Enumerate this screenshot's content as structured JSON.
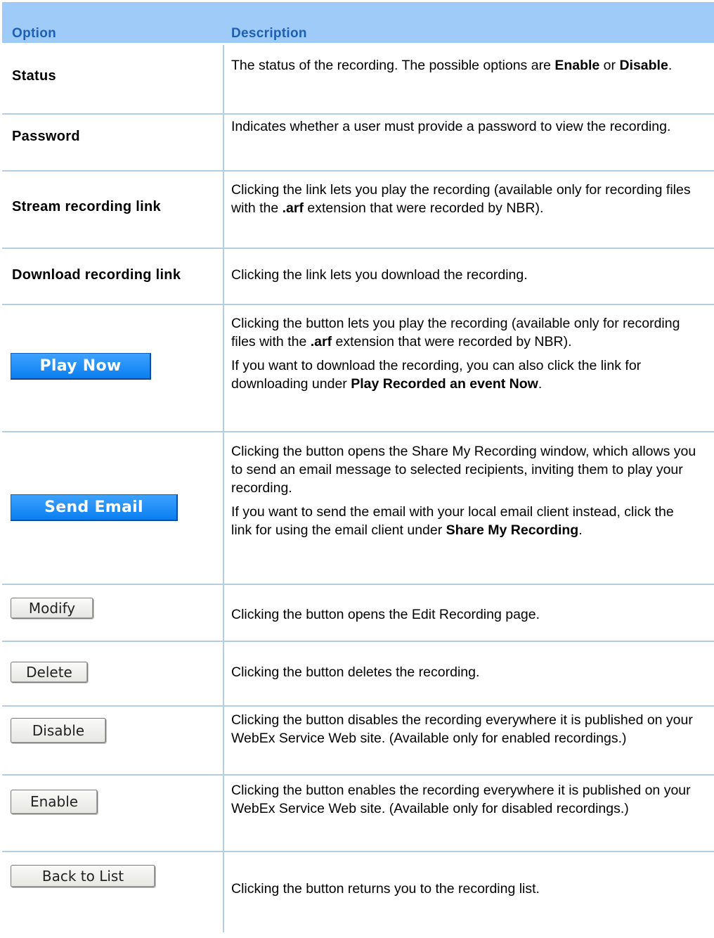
{
  "header": {
    "option": "Option",
    "description": "Description"
  },
  "rows": [
    {
      "option": "Status",
      "desc": [
        "The status of the recording. The possible options are ",
        "Enable",
        " or ",
        "Disable",
        "."
      ]
    },
    {
      "option": "Password",
      "desc": "Indicates whether a user must provide a password to view the recording."
    },
    {
      "option": "Stream recording link",
      "desc": [
        "Clicking the link lets you play the recording (available only for recording files with the ",
        ".arf",
        " extension that were recorded by NBR)."
      ]
    },
    {
      "option": "Download recording link",
      "desc": "Clicking the link lets you download the recording."
    },
    {
      "button": "Play Now",
      "desc1": [
        "Clicking the button lets you play the recording (available only for recording files with the ",
        ".arf",
        " extension that were recorded by NBR)."
      ],
      "desc2": [
        "If you want to download the recording, you can also click the link for downloading under ",
        "Play Recorded an event Now",
        "."
      ]
    },
    {
      "button": "Send Email",
      "desc1": "Clicking the button opens the Share My Recording window, which allows you to send an email message to selected recipients, inviting them to play your recording.",
      "desc2": [
        "If you want to send the email with your local email client instead, click the link for using the email client under ",
        "Share My Recording",
        "."
      ]
    },
    {
      "button": "Modify",
      "desc": "Clicking the button opens the Edit Recording page."
    },
    {
      "button": "Delete",
      "desc": "Clicking the button deletes the recording."
    },
    {
      "button": "Disable",
      "desc": "Clicking the button disables the recording everywhere it is published on your WebEx Service Web site. (Available only for enabled recordings.)"
    },
    {
      "button": "Enable",
      "desc": "Clicking the button enables the recording everywhere it is published on your WebEx Service Web site. (Available only for disabled recordings.)"
    },
    {
      "button": "Back to List",
      "desc": "Clicking the button returns you to the recording list."
    }
  ],
  "colors": {
    "header_bg": "#9fcbf8",
    "header_text": "#1c5fb5",
    "grid": "#b3cfe8",
    "blue_button": "#1d8df7"
  }
}
